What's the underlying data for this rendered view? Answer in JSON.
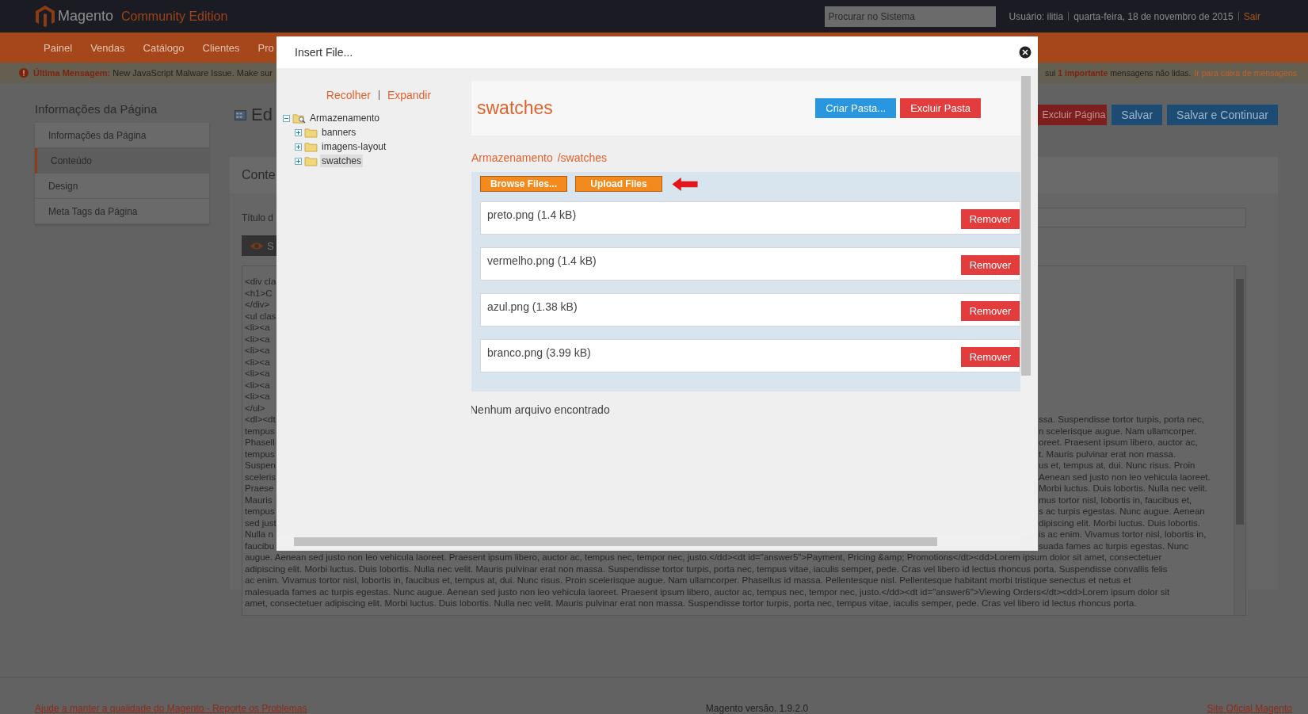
{
  "header": {
    "logo_text": "Magento",
    "edition": "Community Edition",
    "search": {
      "placeholder": "Procurar no Sistema"
    },
    "user": "Usuário: ilitia",
    "date": "quarta-feira, 18 de novembro de 2015",
    "logout": "Sair"
  },
  "nav": [
    "Painel",
    "Vendas",
    "Catálogo",
    "Clientes",
    "Pro"
  ],
  "message_bar": {
    "left": "**Última Mensagem:** New JavaScript Malware Issue. Make sur",
    "right": "sui **1 importante** mensagens não lidas.",
    "link": "Ir para caixa de mensagens"
  },
  "sidebar": {
    "title": "Informações da Página",
    "items": [
      {
        "label": "Informações da Página",
        "selected": false
      },
      {
        "label": "Conteúdo",
        "selected": true
      },
      {
        "label": "Design",
        "selected": false
      },
      {
        "label": "Meta Tags da Página",
        "selected": false
      }
    ]
  },
  "page": {
    "title": "Ed",
    "buttons": [
      {
        "label": "Excluir Página",
        "kind": "danger"
      },
      {
        "label": "Salvar",
        "kind": "primary"
      },
      {
        "label": "Salvar e Continuar",
        "kind": "primary"
      }
    ],
    "section_title": "Conte",
    "field_label": "Título d",
    "toolbar_label": "S",
    "editor_rows": [
      {
        "left": "<div cla"
      },
      {
        "left": "<h1>C"
      },
      {
        "left": "</div>"
      },
      {
        "left": "<ul clas"
      },
      {
        "left": "<li><a"
      },
      {
        "left": "<li><a"
      },
      {
        "left": "<li><a"
      },
      {
        "left": "<li><a"
      },
      {
        "left": "<li><a"
      },
      {
        "left": "<li><a"
      },
      {
        "left": "<li><a"
      },
      {
        "left": "</ul>"
      },
      {
        "left": "<dl><dt",
        "right": "ssa. Suspendisse tortor turpis, porta nec,"
      },
      {
        "left": "tempus",
        "right": "n scelerisque augue. Nam ullamcorper."
      },
      {
        "left": "Phasell",
        "right": "oreet. Praesent ipsum libero, auctor ac,"
      },
      {
        "left": "tempus",
        "right": "t. Mauris pulvinar erat non massa."
      },
      {
        "left": "Suspen",
        "right": "us et, tempus at, dui. Nunc risus. Proin"
      },
      {
        "left": "sceleris",
        "right": "Aenean sed justo non leo vehicula laoreet."
      },
      {
        "left": "Praese",
        "right": "Morbi luctus. Duis lobortis. Nulla nec velit."
      },
      {
        "left": "Mauris",
        "right": "mus tortor nisl, lobortis in, faucibus et,"
      },
      {
        "left": "tempus",
        "right": "s ac turpis egestas. Nunc augue. Aenean"
      },
      {
        "left": "sed just",
        "right": "dipiscing elit. Morbi luctus. Duis lobortis."
      },
      {
        "left": "Nulla n",
        "right": "is ac enim. Vivamus tortor nisl, lobortis in,"
      },
      {
        "left": "faucibu",
        "right": "suada fames ac turpis egestas. Nunc"
      },
      {
        "full": "augue. Aenean sed justo non leo vehicula laoreet. Praesent ipsum libero, auctor ac, tempus nec, tempor nec, justo.</dd><dt id=\"answer5\">Payment, Pricing &amp; Promotions</dt><dd>Lorem ipsum dolor sit amet, consectetuer"
      },
      {
        "full": "adipiscing elit. Morbi luctus. Duis lobortis. Nulla nec velit. Mauris pulvinar erat non massa. Suspendisse tortor turpis, porta nec, tempus vitae, iaculis semper, pede. Cras vel libero id lectus rhoncus porta. Suspendisse convallis felis"
      },
      {
        "full": "ac enim. Vivamus tortor nisl, lobortis in, faucibus et, tempus at, dui. Nunc risus. Proin scelerisque augue. Nam ullamcorper. Phasellus id massa. Pellentesque nisl. Pellentesque habitant morbi tristique senectus et netus et"
      },
      {
        "full": "malesuada fames ac turpis egestas. Nunc augue. Aenean sed justo non leo vehicula laoreet. Praesent ipsum libero, auctor ac, tempus nec, tempor nec, justo.</dd><dt id=\"answer6\">Viewing Orders</dt><dd>Lorem ipsum dolor sit"
      },
      {
        "full": "amet, consectetuer adipiscing elit. Morbi luctus. Duis lobortis. Nulla nec velit. Mauris pulvinar erat non massa. Suspendisse tortor turpis, porta nec, tempus vitae, iaculis semper, pede. Cras vel libero id lectus rhoncus porta."
      }
    ]
  },
  "footer": {
    "left": "Ajude a manter a qualidade do Magento - Reporte os Problemas",
    "center": "Magento versão. 1.9.2.0",
    "right": "Site Oficial Magento"
  },
  "dialog": {
    "title": "Insert File...",
    "tree_actions": [
      "Recolher",
      "Expandir"
    ],
    "tree": [
      {
        "label": "Armazenamento",
        "expanded": true,
        "selected": false,
        "children": [
          {
            "label": "banners",
            "expanded": false,
            "selected": false
          },
          {
            "label": "imagens-layout",
            "expanded": false,
            "selected": false
          },
          {
            "label": "swatches",
            "expanded": false,
            "selected": true
          }
        ]
      }
    ],
    "folder_title": "swatches",
    "folder_buttons": [
      {
        "label": "Criar Pasta...",
        "kind": "primary"
      },
      {
        "label": "Excluir Pasta",
        "kind": "danger"
      }
    ],
    "breadcrumb": [
      "Armazenamento",
      "/swatches"
    ],
    "upload_buttons": [
      "Browse Files...",
      "Upload Files"
    ],
    "files": [
      {
        "name": "preto.png (1.4 kB)",
        "action": "Remover"
      },
      {
        "name": "vermelho.png (1.4 kB)",
        "action": "Remover"
      },
      {
        "name": "azul.png (1.38 kB)",
        "action": "Remover"
      },
      {
        "name": "branco.png (3.99 kB)",
        "action": "Remover"
      }
    ],
    "empty_message": "Nenhum arquivo encontrado"
  }
}
